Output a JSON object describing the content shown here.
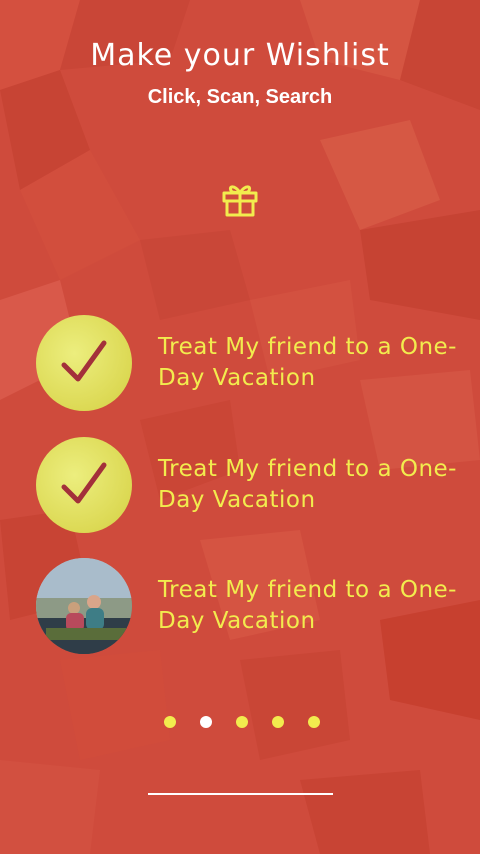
{
  "header": {
    "title": "Make your Wishlist",
    "subtitle": "Click, Scan, Search"
  },
  "icons": {
    "header_icon": "gift-icon",
    "check_icon": "check-icon"
  },
  "colors": {
    "background": "#cf4b3c",
    "accent": "#f2ec4e",
    "check": "#a3303a",
    "text_white": "#ffffff"
  },
  "wishlist": {
    "items": [
      {
        "label": "Treat My friend to a One-Day Vacation",
        "state": "checked"
      },
      {
        "label": "Treat My friend to a One-Day Vacation",
        "state": "checked"
      },
      {
        "label": "Treat My friend to a One-Day Vacation",
        "state": "photo"
      }
    ]
  },
  "pager": {
    "count": 5,
    "active_index": 1
  }
}
